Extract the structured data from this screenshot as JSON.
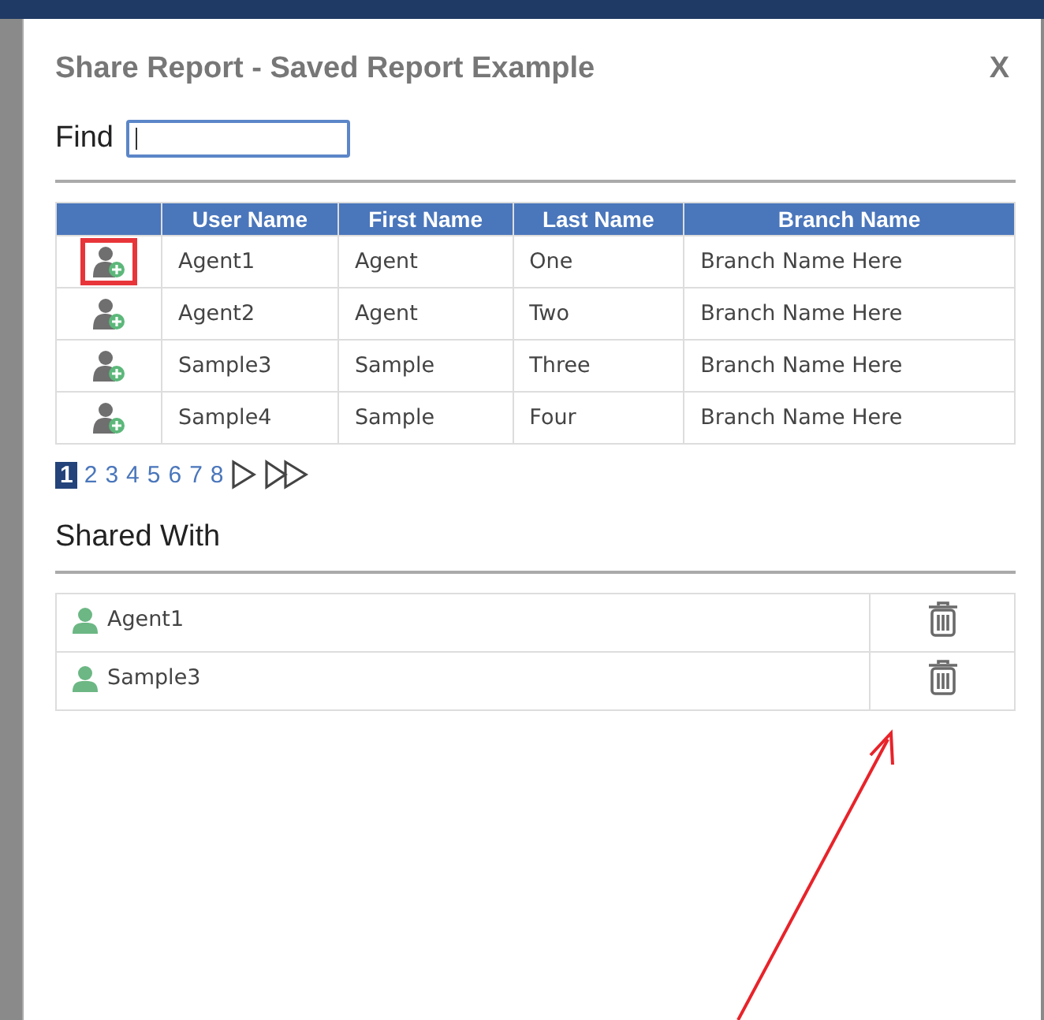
{
  "dialog": {
    "title": "Share Report - Saved Report Example",
    "close": "X"
  },
  "find": {
    "label": "Find",
    "focused": true
  },
  "table": {
    "columns": [
      "User Name",
      "First Name",
      "Last Name",
      "Branch Name"
    ],
    "rows": [
      {
        "highlighted": true,
        "cells": [
          "Agent1",
          "Agent",
          "One",
          "Branch Name Here"
        ]
      },
      {
        "highlighted": false,
        "cells": [
          "Agent2",
          "Agent",
          "Two",
          "Branch Name Here"
        ]
      },
      {
        "highlighted": false,
        "cells": [
          "Sample3",
          "Sample",
          "Three",
          "Branch Name Here"
        ]
      },
      {
        "highlighted": false,
        "cells": [
          "Sample4",
          "Sample",
          "Four",
          "Branch Name Here"
        ]
      }
    ]
  },
  "pagination": {
    "pages": [
      {
        "label": "1",
        "selected": true
      },
      {
        "label": "2",
        "selected": false
      },
      {
        "label": "3",
        "selected": false
      },
      {
        "label": "4",
        "selected": false
      },
      {
        "label": "5",
        "selected": false
      },
      {
        "label": "6",
        "selected": false
      },
      {
        "label": "7",
        "selected": false
      },
      {
        "label": "8",
        "selected": false
      }
    ]
  },
  "shared_with": {
    "title": "Shared With",
    "users": [
      "Agent1",
      "Sample3"
    ]
  },
  "annotation": {
    "kind": "arrow"
  }
}
